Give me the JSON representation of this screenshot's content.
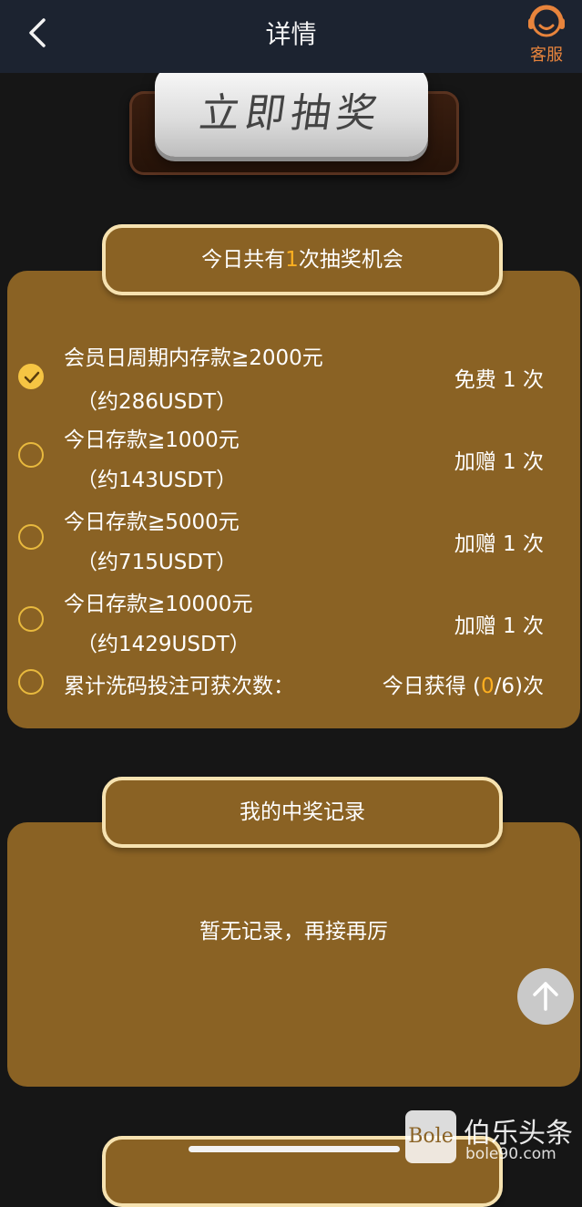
{
  "header": {
    "title": "详情",
    "customer_service": "客服"
  },
  "draw_button": {
    "label": "立即抽奖"
  },
  "chances": {
    "prefix": "今日共有",
    "count": "1",
    "suffix": "次抽奖机会",
    "rows": [
      {
        "condition": "会员日周期内存款≧2000元",
        "note": "（约286USDT）",
        "reward": "免费 1 次",
        "checked": true
      },
      {
        "condition": "今日存款≧1000元",
        "note": "（约143USDT）",
        "reward": "加赠 1 次",
        "checked": false
      },
      {
        "condition": "今日存款≧5000元",
        "note": "（约715USDT）",
        "reward": "加赠 1 次",
        "checked": false
      },
      {
        "condition": "今日存款≧10000元",
        "note": "（约1429USDT）",
        "reward": "加赠 1 次",
        "checked": false
      }
    ],
    "wash": {
      "condition": "累计洗码投注可获次数：",
      "prefix": "今日获得 (",
      "current": "0",
      "suffix": "/6)次"
    }
  },
  "records": {
    "title": "我的中奖记录",
    "empty_text": "暂无记录，再接再厉"
  },
  "watermark": {
    "logo": "Bole",
    "title": "伯乐头条",
    "url": "bole90.com"
  },
  "colors": {
    "panel": "#8a6224",
    "accent": "#ffb020",
    "customer_service": "#e8843c"
  },
  "icons": [
    "back-arrow-icon",
    "customer-service-icon",
    "check-icon",
    "arrow-up-icon"
  ]
}
